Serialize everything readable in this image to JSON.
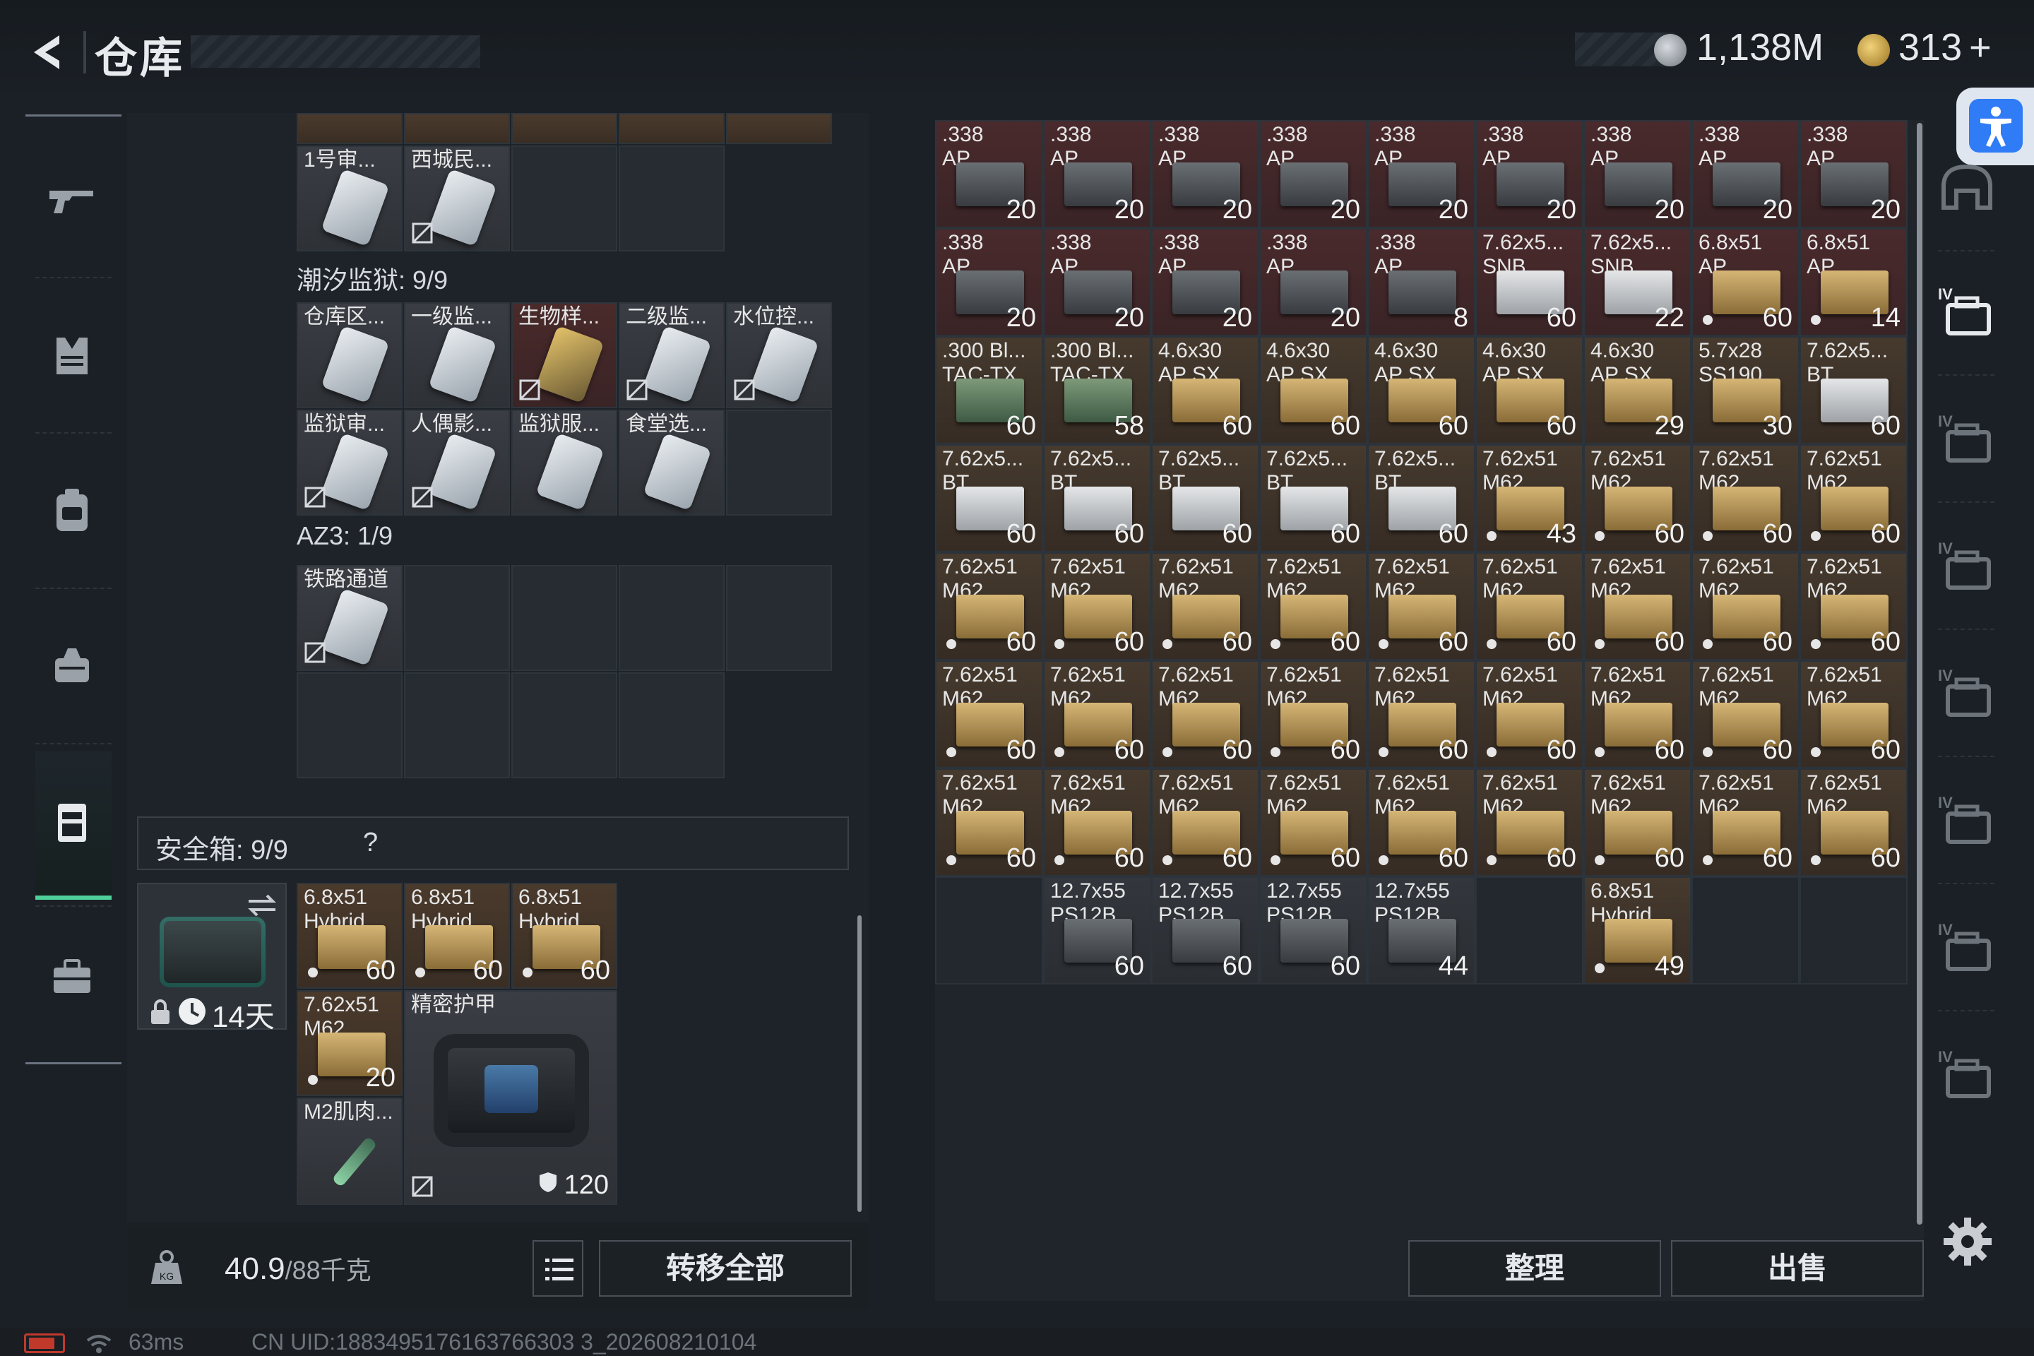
{
  "header": {
    "title": "仓库",
    "money": "1,138M",
    "bonds": "313",
    "add_symbol": "+"
  },
  "left_panel": {
    "top_items": [
      {
        "label": "1号审...",
        "type": "card",
        "bound": false
      },
      {
        "label": "西城民...",
        "type": "card",
        "bound": true
      }
    ],
    "section_tidal": {
      "title": "潮汐监狱: 9/9",
      "items": [
        {
          "label": "仓库区...",
          "type": "card",
          "color": "gray",
          "bound": false
        },
        {
          "label": "一级监...",
          "type": "card",
          "color": "gray",
          "bound": false
        },
        {
          "label": "生物样...",
          "type": "gold",
          "color": "red",
          "bound": true
        },
        {
          "label": "二级监...",
          "type": "card",
          "color": "gray",
          "bound": true
        },
        {
          "label": "水位控...",
          "type": "card",
          "color": "gray",
          "bound": true
        },
        {
          "label": "监狱审...",
          "type": "card",
          "color": "gray",
          "bound": true
        },
        {
          "label": "人偶影...",
          "type": "card",
          "color": "gray",
          "bound": true
        },
        {
          "label": "监狱服...",
          "type": "card",
          "color": "gray",
          "bound": false
        },
        {
          "label": "食堂选...",
          "type": "card",
          "color": "gray",
          "bound": false
        }
      ]
    },
    "section_az3": {
      "title": "AZ3: 1/9",
      "items": [
        {
          "label": "铁路通道",
          "type": "card",
          "bound": true
        }
      ]
    },
    "safebox": {
      "title": "安全箱: 9/9",
      "help": "?",
      "duration": "14天",
      "items": [
        {
          "l1": "6.8x51",
          "l2": "Hybrid",
          "qty": "60",
          "type": "box"
        },
        {
          "l1": "6.8x51",
          "l2": "Hybrid",
          "qty": "60",
          "type": "box"
        },
        {
          "l1": "6.8x51",
          "l2": "Hybrid",
          "qty": "60",
          "type": "box"
        },
        {
          "l1": "7.62x51",
          "l2": "M62",
          "qty": "20",
          "type": "box"
        },
        {
          "l1": "精密护甲",
          "l2": "",
          "qty": "120",
          "type": "armor"
        },
        {
          "l1": "M2肌肉...",
          "l2": "",
          "qty": "",
          "type": "syringe"
        }
      ]
    }
  },
  "bottom": {
    "weight": "40.9",
    "weight_max": "/88千克",
    "transfer_all": "转移全部",
    "sort": "整理",
    "sell": "出售"
  },
  "status_bar": {
    "ping": "63ms",
    "uid": "CN UID:1883495176163766303 3_202608210104"
  },
  "stash": [
    [
      {
        "l1": ".338",
        "l2": "AP",
        "qty": "20",
        "t": "dark",
        "bg": "red"
      },
      {
        "l1": ".338",
        "l2": "AP",
        "qty": "20",
        "t": "dark",
        "bg": "red"
      },
      {
        "l1": ".338",
        "l2": "AP",
        "qty": "20",
        "t": "dark",
        "bg": "red"
      },
      {
        "l1": ".338",
        "l2": "AP",
        "qty": "20",
        "t": "dark",
        "bg": "red"
      },
      {
        "l1": ".338",
        "l2": "AP",
        "qty": "20",
        "t": "dark",
        "bg": "red"
      },
      {
        "l1": ".338",
        "l2": "AP",
        "qty": "20",
        "t": "dark",
        "bg": "red"
      },
      {
        "l1": ".338",
        "l2": "AP",
        "qty": "20",
        "t": "dark",
        "bg": "red"
      },
      {
        "l1": ".338",
        "l2": "AP",
        "qty": "20",
        "t": "dark",
        "bg": "red"
      },
      {
        "l1": ".338",
        "l2": "AP",
        "qty": "20",
        "t": "dark",
        "bg": "red"
      }
    ],
    [
      {
        "l1": ".338",
        "l2": "AP",
        "qty": "20",
        "t": "dark",
        "bg": "red"
      },
      {
        "l1": ".338",
        "l2": "AP",
        "qty": "20",
        "t": "dark",
        "bg": "red"
      },
      {
        "l1": ".338",
        "l2": "AP",
        "qty": "20",
        "t": "dark",
        "bg": "red"
      },
      {
        "l1": ".338",
        "l2": "AP",
        "qty": "20",
        "t": "dark",
        "bg": "red"
      },
      {
        "l1": ".338",
        "l2": "AP",
        "qty": "8",
        "t": "dark",
        "bg": "red"
      },
      {
        "l1": "7.62x5...",
        "l2": "SNB",
        "qty": "60",
        "t": "white",
        "bg": "red"
      },
      {
        "l1": "7.62x5...",
        "l2": "SNB",
        "qty": "22",
        "t": "white",
        "bg": "red"
      },
      {
        "l1": "6.8x51",
        "l2": "AP",
        "qty": "60",
        "t": "box",
        "bg": "red",
        "dot": true
      },
      {
        "l1": "6.8x51",
        "l2": "AP",
        "qty": "14",
        "t": "box",
        "bg": "red",
        "dot": true
      }
    ],
    [
      {
        "l1": ".300 Bl...",
        "l2": "TAC-TX",
        "qty": "60",
        "t": "green",
        "bg": "tan"
      },
      {
        "l1": ".300 Bl...",
        "l2": "TAC-TX",
        "qty": "58",
        "t": "green",
        "bg": "tan"
      },
      {
        "l1": "4.6x30",
        "l2": "AP SX",
        "qty": "60",
        "t": "box",
        "bg": "tan"
      },
      {
        "l1": "4.6x30",
        "l2": "AP SX",
        "qty": "60",
        "t": "box",
        "bg": "tan"
      },
      {
        "l1": "4.6x30",
        "l2": "AP SX",
        "qty": "60",
        "t": "box",
        "bg": "tan"
      },
      {
        "l1": "4.6x30",
        "l2": "AP SX",
        "qty": "60",
        "t": "box",
        "bg": "tan"
      },
      {
        "l1": "4.6x30",
        "l2": "AP SX",
        "qty": "29",
        "t": "box",
        "bg": "tan"
      },
      {
        "l1": "5.7x28",
        "l2": "SS190",
        "qty": "30",
        "t": "box",
        "bg": "tan"
      },
      {
        "l1": "7.62x5...",
        "l2": "BT",
        "qty": "60",
        "t": "white",
        "bg": "tan"
      }
    ],
    [
      {
        "l1": "7.62x5...",
        "l2": "BT",
        "qty": "60",
        "t": "white",
        "bg": "tan"
      },
      {
        "l1": "7.62x5...",
        "l2": "BT",
        "qty": "60",
        "t": "white",
        "bg": "tan"
      },
      {
        "l1": "7.62x5...",
        "l2": "BT",
        "qty": "60",
        "t": "white",
        "bg": "tan"
      },
      {
        "l1": "7.62x5...",
        "l2": "BT",
        "qty": "60",
        "t": "white",
        "bg": "tan"
      },
      {
        "l1": "7.62x5...",
        "l2": "BT",
        "qty": "60",
        "t": "white",
        "bg": "tan"
      },
      {
        "l1": "7.62x51",
        "l2": "M62",
        "qty": "43",
        "t": "box",
        "bg": "tan",
        "dot": true
      },
      {
        "l1": "7.62x51",
        "l2": "M62",
        "qty": "60",
        "t": "box",
        "bg": "tan",
        "dot": true
      },
      {
        "l1": "7.62x51",
        "l2": "M62",
        "qty": "60",
        "t": "box",
        "bg": "tan",
        "dot": true
      },
      {
        "l1": "7.62x51",
        "l2": "M62",
        "qty": "60",
        "t": "box",
        "bg": "tan",
        "dot": true
      }
    ],
    [
      {
        "l1": "7.62x51",
        "l2": "M62",
        "qty": "60",
        "t": "box",
        "bg": "tan",
        "dot": true
      },
      {
        "l1": "7.62x51",
        "l2": "M62",
        "qty": "60",
        "t": "box",
        "bg": "tan",
        "dot": true
      },
      {
        "l1": "7.62x51",
        "l2": "M62",
        "qty": "60",
        "t": "box",
        "bg": "tan",
        "dot": true
      },
      {
        "l1": "7.62x51",
        "l2": "M62",
        "qty": "60",
        "t": "box",
        "bg": "tan",
        "dot": true
      },
      {
        "l1": "7.62x51",
        "l2": "M62",
        "qty": "60",
        "t": "box",
        "bg": "tan",
        "dot": true
      },
      {
        "l1": "7.62x51",
        "l2": "M62",
        "qty": "60",
        "t": "box",
        "bg": "tan",
        "dot": true
      },
      {
        "l1": "7.62x51",
        "l2": "M62",
        "qty": "60",
        "t": "box",
        "bg": "tan",
        "dot": true
      },
      {
        "l1": "7.62x51",
        "l2": "M62",
        "qty": "60",
        "t": "box",
        "bg": "tan",
        "dot": true
      },
      {
        "l1": "7.62x51",
        "l2": "M62",
        "qty": "60",
        "t": "box",
        "bg": "tan",
        "dot": true
      }
    ],
    [
      {
        "l1": "7.62x51",
        "l2": "M62",
        "qty": "60",
        "t": "box",
        "bg": "tan",
        "dot": true
      },
      {
        "l1": "7.62x51",
        "l2": "M62",
        "qty": "60",
        "t": "box",
        "bg": "tan",
        "dot": true
      },
      {
        "l1": "7.62x51",
        "l2": "M62",
        "qty": "60",
        "t": "box",
        "bg": "tan",
        "dot": true
      },
      {
        "l1": "7.62x51",
        "l2": "M62",
        "qty": "60",
        "t": "box",
        "bg": "tan",
        "dot": true
      },
      {
        "l1": "7.62x51",
        "l2": "M62",
        "qty": "60",
        "t": "box",
        "bg": "tan",
        "dot": true
      },
      {
        "l1": "7.62x51",
        "l2": "M62",
        "qty": "60",
        "t": "box",
        "bg": "tan",
        "dot": true
      },
      {
        "l1": "7.62x51",
        "l2": "M62",
        "qty": "60",
        "t": "box",
        "bg": "tan",
        "dot": true
      },
      {
        "l1": "7.62x51",
        "l2": "M62",
        "qty": "60",
        "t": "box",
        "bg": "tan",
        "dot": true
      },
      {
        "l1": "7.62x51",
        "l2": "M62",
        "qty": "60",
        "t": "box",
        "bg": "tan",
        "dot": true
      }
    ],
    [
      {
        "l1": "7.62x51",
        "l2": "M62",
        "qty": "60",
        "t": "box",
        "bg": "tan",
        "dot": true
      },
      {
        "l1": "7.62x51",
        "l2": "M62",
        "qty": "60",
        "t": "box",
        "bg": "tan",
        "dot": true
      },
      {
        "l1": "7.62x51",
        "l2": "M62",
        "qty": "60",
        "t": "box",
        "bg": "tan",
        "dot": true
      },
      {
        "l1": "7.62x51",
        "l2": "M62",
        "qty": "60",
        "t": "box",
        "bg": "tan",
        "dot": true
      },
      {
        "l1": "7.62x51",
        "l2": "M62",
        "qty": "60",
        "t": "box",
        "bg": "tan",
        "dot": true
      },
      {
        "l1": "7.62x51",
        "l2": "M62",
        "qty": "60",
        "t": "box",
        "bg": "tan",
        "dot": true
      },
      {
        "l1": "7.62x51",
        "l2": "M62",
        "qty": "60",
        "t": "box",
        "bg": "tan",
        "dot": true
      },
      {
        "l1": "7.62x51",
        "l2": "M62",
        "qty": "60",
        "t": "box",
        "bg": "tan",
        "dot": true
      },
      {
        "l1": "7.62x51",
        "l2": "M62",
        "qty": "60",
        "t": "box",
        "bg": "tan",
        "dot": true
      }
    ],
    [
      null,
      {
        "l1": "12.7x55",
        "l2": "PS12B",
        "qty": "60",
        "t": "dark",
        "bg": "gray"
      },
      {
        "l1": "12.7x55",
        "l2": "PS12B",
        "qty": "60",
        "t": "dark",
        "bg": "gray"
      },
      {
        "l1": "12.7x55",
        "l2": "PS12B",
        "qty": "60",
        "t": "dark",
        "bg": "gray"
      },
      {
        "l1": "12.7x55",
        "l2": "PS12B",
        "qty": "44",
        "t": "dark",
        "bg": "gray"
      },
      null,
      {
        "l1": "6.8x51",
        "l2": "Hybrid",
        "qty": "49",
        "t": "box",
        "bg": "tan",
        "dot": true
      },
      null,
      null
    ]
  ],
  "colors": {
    "accent": "#4fd09a",
    "background": "#1b2026",
    "cell_red": "#4a2a2a",
    "cell_tan": "#4a3a2c",
    "accessibility": "#2f7cf6"
  },
  "icons": {
    "back": "back-arrow-icon",
    "nav": [
      "gun-icon",
      "armor-vest-icon",
      "backpack-icon",
      "chest-rig-icon",
      "safebox-icon",
      "briefcase-icon"
    ],
    "right": [
      "helmet-icon",
      "storage-icon",
      "medkit-icon",
      "ammo-case-icon",
      "weapon-case-icon",
      "keycard-case-icon",
      "tool-case-icon",
      "vault-icon"
    ],
    "settings": "gear-icon",
    "accessibility": "accessibility-icon"
  }
}
